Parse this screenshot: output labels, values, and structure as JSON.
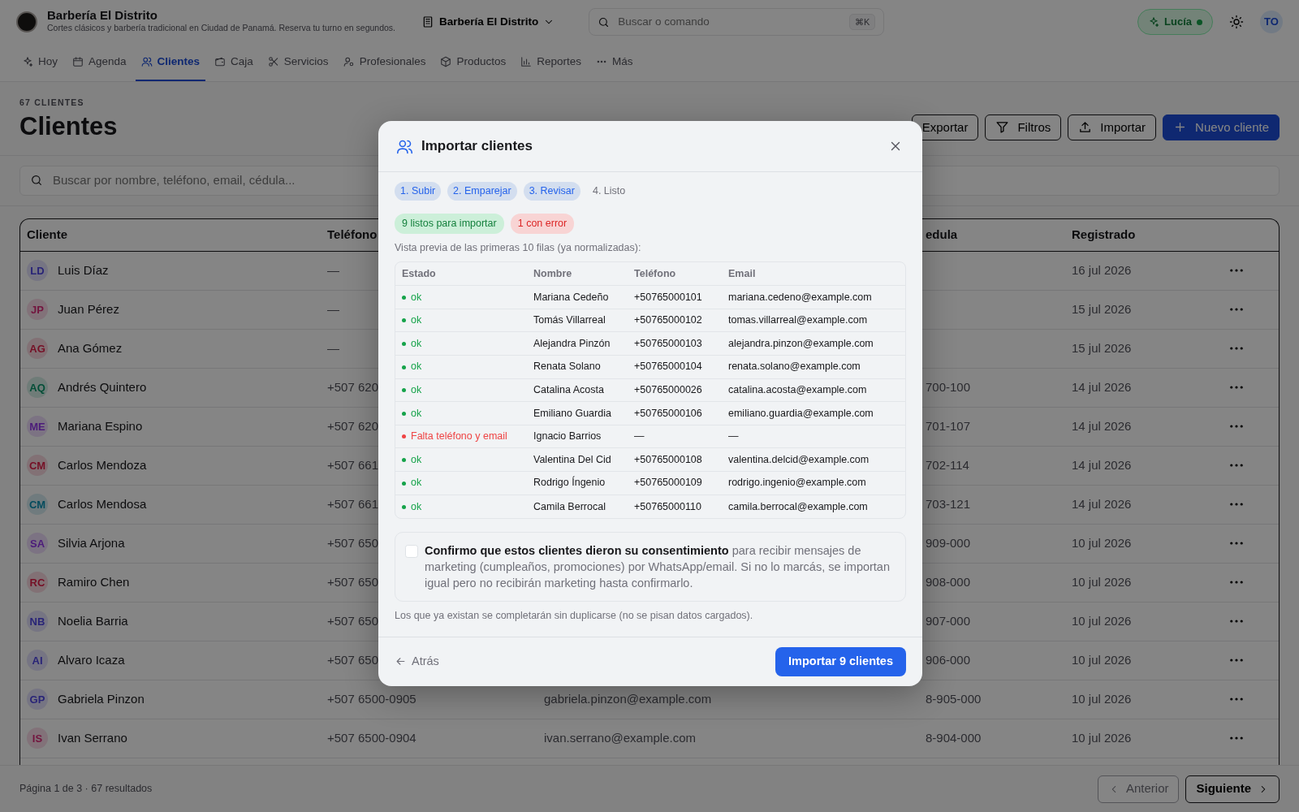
{
  "app": {
    "title": "Barbería El Distrito",
    "subtitle": "Cortes clásicos y barbería tradicional en Ciudad de Panamá. Reserva tu turno en segundos.",
    "location": "Barbería El Distrito",
    "search": {
      "placeholder": "Buscar o comando"
    },
    "shortcut": "⌘K",
    "assistant": "Lucía",
    "user_initials": "TO"
  },
  "tabs": [
    {
      "label": "Hoy",
      "selected": false
    },
    {
      "label": "Agenda",
      "selected": false
    },
    {
      "label": "Clientes",
      "selected": true
    },
    {
      "label": "Caja",
      "selected": false
    },
    {
      "label": "Servicios",
      "selected": false
    },
    {
      "label": "Profesionales",
      "selected": false
    },
    {
      "label": "Productos",
      "selected": false
    },
    {
      "label": "Reportes",
      "selected": false
    },
    {
      "label": "Más",
      "selected": false
    }
  ],
  "page": {
    "overline": "67 CLIENTES",
    "title": "Clientes",
    "actions": [
      {
        "label": "Exportar",
        "kind": "outline"
      },
      {
        "label": "Filtros",
        "kind": "outline"
      },
      {
        "label": "Importar",
        "kind": "outline"
      },
      {
        "label": "Nuevo cliente",
        "kind": "primary"
      }
    ]
  },
  "search": {
    "placeholder": "Buscar por nombre, teléfono, email, cédula..."
  },
  "table": {
    "columns": {
      "client": "Cliente",
      "phone": "Teléfono",
      "cedula": "edula",
      "registered": "Registrado"
    },
    "rows": [
      {
        "initials": "LD",
        "name": "Luis Díaz",
        "color": "#292477",
        "phone": "—",
        "registered": "16 jul 2026"
      },
      {
        "initials": "JP",
        "name": "Juan Pérez",
        "color": "#72143e",
        "phone": "—",
        "registered": "15 jul 2026"
      },
      {
        "initials": "AG",
        "name": "Ana Gómez",
        "color": "#750f25",
        "phone": "—",
        "registered": "15 jul 2026"
      },
      {
        "initials": "AQ",
        "name": "Andrés Quintero",
        "color": "#034e37",
        "phone": "+507 620",
        "cedula": "700-100",
        "registered": "14 jul 2026"
      },
      {
        "initials": "ME",
        "name": "Mariana Espino",
        "color": "#4c1b7a",
        "phone": "+507 620",
        "cedula": "701-107",
        "registered": "14 jul 2026"
      },
      {
        "initials": "CM",
        "name": "Carlos Mendoza",
        "color": "#750f25",
        "phone": "+507 661",
        "cedula": "702-114",
        "registered": "14 jul 2026"
      },
      {
        "initials": "CM",
        "name": "Carlos Mendosa",
        "color": "#044b5d",
        "phone": "+507 661",
        "cedula": "703-121",
        "registered": "14 jul 2026"
      },
      {
        "initials": "SA",
        "name": "Silvia Arjona",
        "color": "#4c1b7a",
        "phone": "+507 650",
        "cedula": "909-000",
        "registered": "10 jul 2026"
      },
      {
        "initials": "RC",
        "name": "Ramiro Chen",
        "color": "#750f25",
        "phone": "+507 650",
        "cedula": "908-000",
        "registered": "10 jul 2026"
      },
      {
        "initials": "NB",
        "name": "Noelia Barria",
        "color": "#292477",
        "phone": "+507 650",
        "cedula": "907-000",
        "registered": "10 jul 2026"
      },
      {
        "initials": "AI",
        "name": "Alvaro Icaza",
        "color": "#292477",
        "phone": "+507 650",
        "cedula": "906-000",
        "registered": "10 jul 2026"
      },
      {
        "initials": "GP",
        "name": "Gabriela Pinzon",
        "color": "#292477",
        "phone": "+507 6500-0905",
        "email": "gabriela.pinzon@example.com",
        "cedula": "8-905-000",
        "registered": "10 jul 2026"
      },
      {
        "initials": "IS",
        "name": "Ivan Serrano",
        "color": "#72143e",
        "phone": "+507 6500-0904",
        "email": "ivan.serrano@example.com",
        "cedula": "8-904-000",
        "registered": "10 jul 2026"
      }
    ]
  },
  "footer": {
    "summary": "Página 1 de 3 · 67 resultados",
    "previous": {
      "label": "Anterior",
      "disabled": true
    },
    "next": {
      "label": "Siguiente",
      "disabled": false
    }
  },
  "modal": {
    "title": "Importar clientes",
    "steps": [
      {
        "label": "1. Subir",
        "done": true
      },
      {
        "label": "2. Emparejar",
        "done": true
      },
      {
        "label": "3. Revisar",
        "done": true
      },
      {
        "label": "4. Listo",
        "done": false
      }
    ],
    "summary": [
      {
        "label": "9 listos para importar",
        "kind": "ok"
      },
      {
        "label": "1 con error",
        "kind": "error"
      }
    ],
    "preview_caption": "Vista previa de las primeras 10 filas (ya normalizadas):",
    "preview": {
      "columns": [
        "Estado",
        "Nombre",
        "Teléfono",
        "Email"
      ],
      "rows": [
        {
          "kind": "ok",
          "status": "ok",
          "name": "Mariana Cedeño",
          "phone": "+50765000101",
          "email": "mariana.cedeno@example.com"
        },
        {
          "kind": "ok",
          "status": "ok",
          "name": "Tomás Villarreal",
          "phone": "+50765000102",
          "email": "tomas.villarreal@example.com"
        },
        {
          "kind": "ok",
          "status": "ok",
          "name": "Alejandra Pinzón",
          "phone": "+50765000103",
          "email": "alejandra.pinzon@example.com"
        },
        {
          "kind": "ok",
          "status": "ok",
          "name": "Renata Solano",
          "phone": "+50765000104",
          "email": "renata.solano@example.com"
        },
        {
          "kind": "ok",
          "status": "ok",
          "name": "Catalina Acosta",
          "phone": "+50765000026",
          "email": "catalina.acosta@example.com"
        },
        {
          "kind": "ok",
          "status": "ok",
          "name": "Emiliano Guardia",
          "phone": "+50765000106",
          "email": "emiliano.guardia@example.com"
        },
        {
          "kind": "error",
          "status": "Falta teléfono y email",
          "name": "Ignacio Barrios",
          "phone": "—",
          "email": "—"
        },
        {
          "kind": "ok",
          "status": "ok",
          "name": "Valentina Del Cid",
          "phone": "+50765000108",
          "email": "valentina.delcid@example.com"
        },
        {
          "kind": "ok",
          "status": "ok",
          "name": "Rodrigo Íngenio",
          "phone": "+50765000109",
          "email": "rodrigo.ingenio@example.com"
        },
        {
          "kind": "ok",
          "status": "ok",
          "name": "Camila Berrocal",
          "phone": "+50765000110",
          "email": "camila.berrocal@example.com"
        }
      ]
    },
    "consent": {
      "checked": false,
      "text": "**Confirmo que estos clientes dieron su consentimiento** para recibir mensajes de marketing (cumpleaños, promociones) por WhatsApp/email. Si no lo marcás, se importan igual pero no recibirán marketing hasta confirmarlo."
    },
    "note": "Los que ya existan se completarán sin duplicarse (no se pisan datos cargados).",
    "back": "Atrás",
    "submit": "Importar 9 clientes"
  }
}
